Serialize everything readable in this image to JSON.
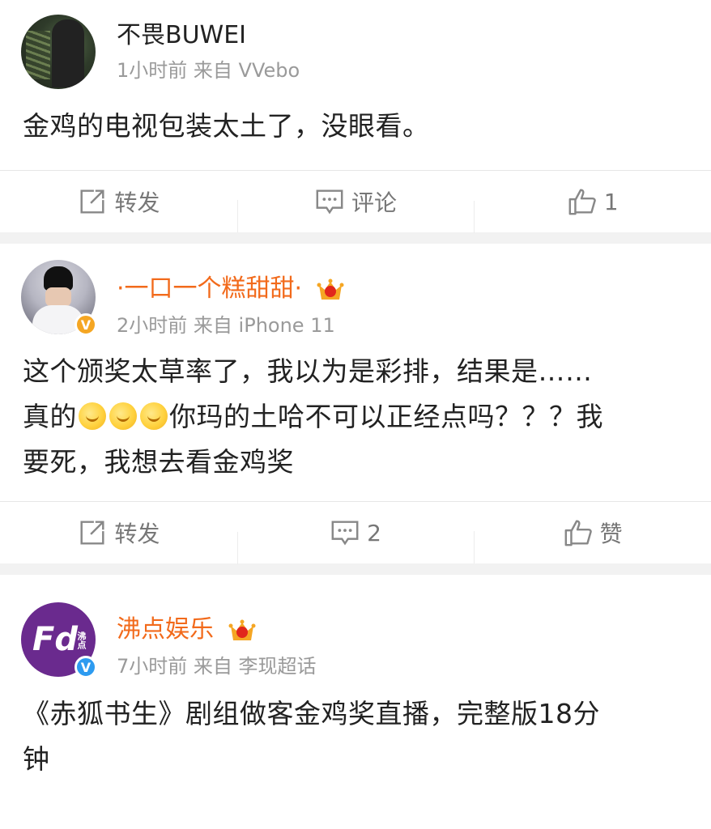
{
  "posts": [
    {
      "username": "不畏BUWEI",
      "time": "1小时前",
      "source": "来自 VVebo",
      "text_lines": [
        "金鸡的电视包装太土了，没眼看。"
      ],
      "actions": {
        "repost": "转发",
        "comment": "评论",
        "like": "1"
      }
    },
    {
      "username": "·一口一个糕甜甜·",
      "time": "2小时前",
      "source": "来自 iPhone 11",
      "text_line1": "这个颁奖太草率了，我以为是彩排，结果是……",
      "text_line2_a": "真的",
      "text_line2_b": "你玛的土哈不可以正经点吗？？？我",
      "text_line3": "要死，我想去看金鸡奖",
      "actions": {
        "repost": "转发",
        "comment": "2",
        "like": "赞"
      }
    },
    {
      "username": "沸点娱乐",
      "time": "7小时前",
      "source": "来自 李现超话",
      "avatar_text": "Fd",
      "avatar_sub": "沸点",
      "text_lines": [
        "《赤狐书生》剧组做客金鸡奖直播，完整版18分",
        "钟"
      ]
    }
  ],
  "colors": {
    "orange_name": "#f26a1b",
    "verified_badge": "#f5a623",
    "brand_purple": "#6a2a8e"
  }
}
